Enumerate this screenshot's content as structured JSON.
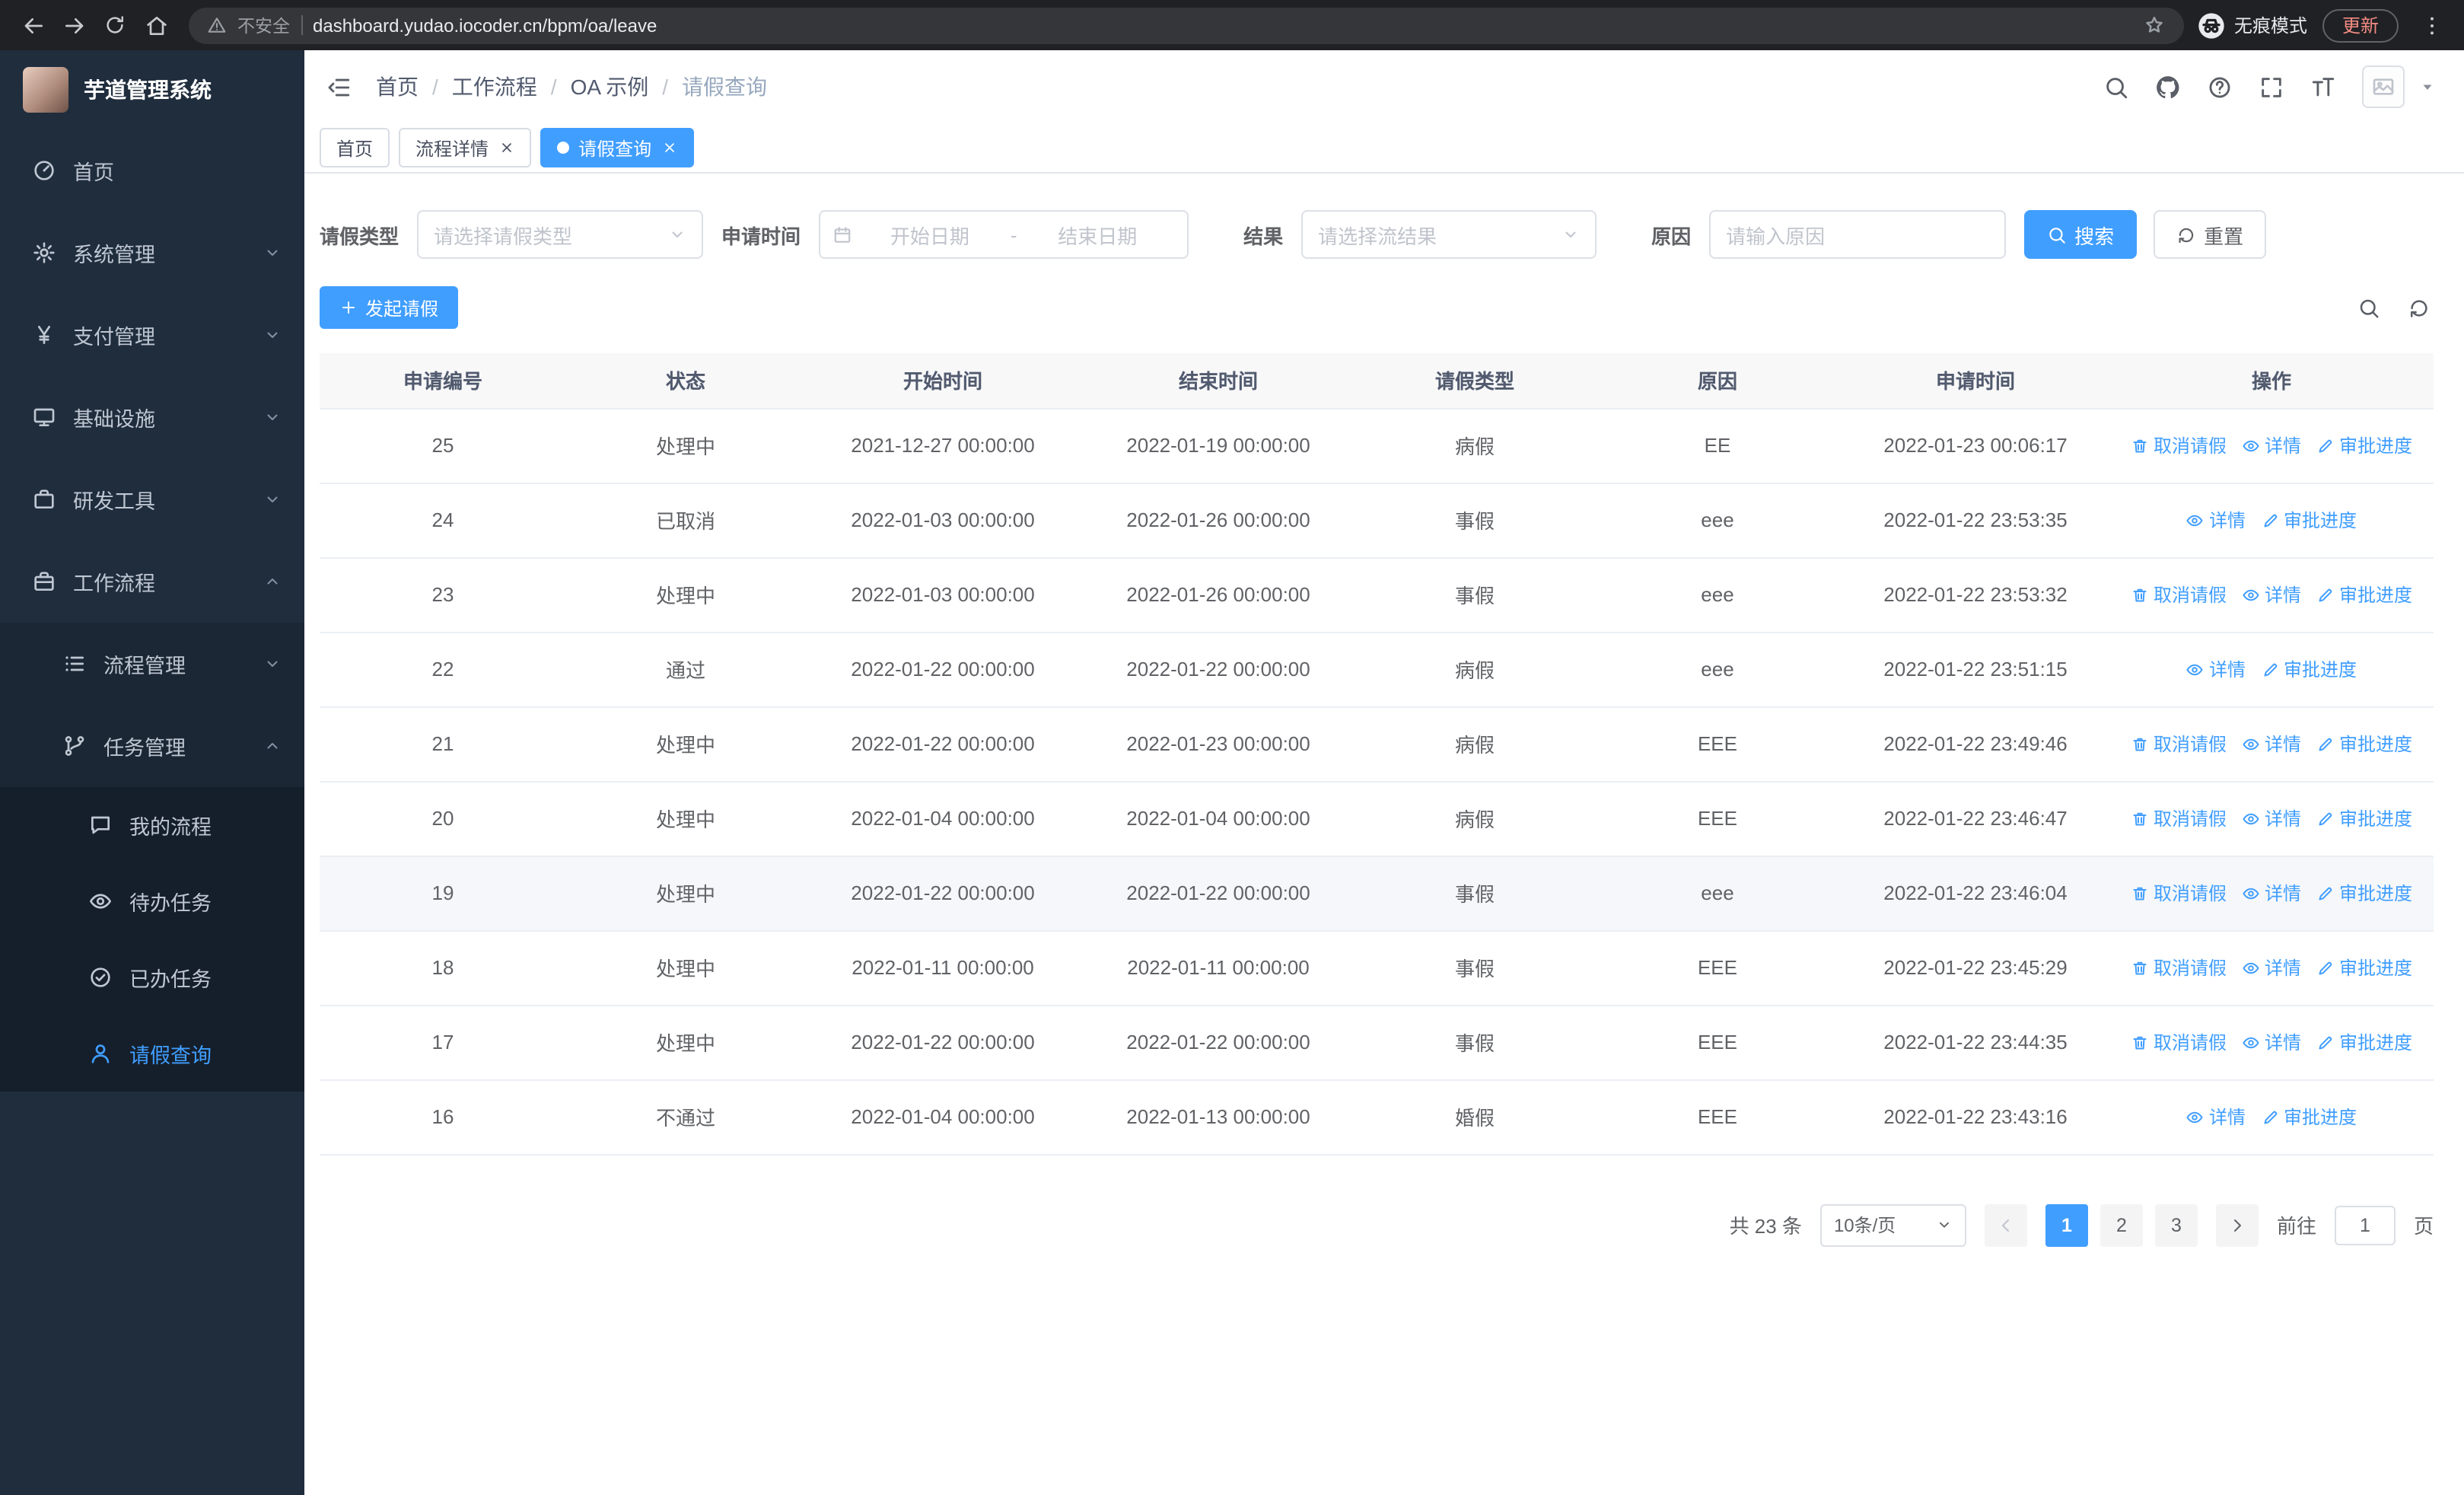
{
  "colors": {
    "primary": "#409EFF",
    "sidebar_bg": "#1F2D3D",
    "chrome_bg": "#202124",
    "update_text": "#F28B82",
    "table_header_bg": "#F8F8F9",
    "row_highlight_bg": "#F5F7FA"
  },
  "browser": {
    "security_warning": "不安全",
    "url": "dashboard.yudao.iocoder.cn/bpm/oa/leave",
    "incognito_label": "无痕模式",
    "update_label": "更新",
    "icons": [
      "back-icon",
      "forward-icon",
      "reload-icon",
      "home-icon",
      "warning-icon",
      "star-icon",
      "incognito-icon",
      "more-icon"
    ]
  },
  "sidebar": {
    "logo_title": "芋道管理系统",
    "menu": [
      {
        "id": "home",
        "label": "首页",
        "icon": "dashboard-icon",
        "level": 1
      },
      {
        "id": "system-mgmt",
        "label": "系统管理",
        "icon": "gear-icon",
        "level": 1,
        "chevron": "down"
      },
      {
        "id": "payment-mgmt",
        "label": "支付管理",
        "icon": "yen-icon",
        "level": 1,
        "chevron": "down"
      },
      {
        "id": "infrastructure",
        "label": "基础设施",
        "icon": "infra-icon",
        "level": 1,
        "chevron": "down"
      },
      {
        "id": "dev-tools",
        "label": "研发工具",
        "icon": "tools-icon",
        "level": 1,
        "chevron": "down"
      },
      {
        "id": "workflow",
        "label": "工作流程",
        "icon": "workflow-icon",
        "level": 1,
        "chevron": "up"
      },
      {
        "id": "process-mgmt",
        "label": "流程管理",
        "icon": "process-icon",
        "level": 2,
        "chevron": "down"
      },
      {
        "id": "task-mgmt",
        "label": "任务管理",
        "icon": "task-icon",
        "level": 2,
        "chevron": "up"
      },
      {
        "id": "my-process",
        "label": "我的流程",
        "icon": "chat-icon",
        "level": 3
      },
      {
        "id": "todo-task",
        "label": "待办任务",
        "icon": "eye-icon",
        "level": 3
      },
      {
        "id": "done-task",
        "label": "已办任务",
        "icon": "done-icon",
        "level": 3
      },
      {
        "id": "leave-query",
        "label": "请假查询",
        "icon": "user-icon",
        "level": 3,
        "active": true
      }
    ]
  },
  "header": {
    "breadcrumb": [
      "首页",
      "工作流程",
      "OA 示例",
      "请假查询"
    ],
    "icons": [
      "search-icon",
      "github-icon",
      "help-icon",
      "fullscreen-icon",
      "fontsize-icon"
    ]
  },
  "tabs": [
    {
      "id": "home",
      "label": "首页",
      "active": false,
      "closable": false
    },
    {
      "id": "process-detail",
      "label": "流程详情",
      "active": false,
      "closable": true
    },
    {
      "id": "leave-query",
      "label": "请假查询",
      "active": true,
      "closable": true
    }
  ],
  "filters": {
    "leave_type_label": "请假类型",
    "leave_type_placeholder": "请选择请假类型",
    "apply_time_label": "申请时间",
    "start_date_placeholder": "开始日期",
    "range_separator": "-",
    "end_date_placeholder": "结束日期",
    "result_label": "结果",
    "result_placeholder": "请选择流结果",
    "reason_label": "原因",
    "reason_placeholder": "请输入原因",
    "search_label": "搜索",
    "reset_label": "重置",
    "icons": [
      "calendar-icon",
      "chevron-down-icon",
      "search-icon",
      "refresh-icon"
    ]
  },
  "toolbar": {
    "create_label": "发起请假",
    "icons": [
      "plus-icon",
      "search-icon",
      "refresh-icon"
    ]
  },
  "table": {
    "columns": [
      "申请编号",
      "状态",
      "开始时间",
      "结束时间",
      "请假类型",
      "原因",
      "申请时间",
      "操作"
    ],
    "action_labels": {
      "cancel": "取消请假",
      "detail": "详情",
      "progress": "审批进度"
    },
    "action_icons": {
      "cancel": "trash-icon",
      "detail": "eye-icon",
      "progress": "edit-icon"
    },
    "rows": [
      {
        "id": "25",
        "status": "处理中",
        "start": "2021-12-27 00:00:00",
        "end": "2022-01-19 00:00:00",
        "type": "病假",
        "reason": "EE",
        "applied": "2022-01-23 00:06:17",
        "actions": [
          "cancel",
          "detail",
          "progress"
        ]
      },
      {
        "id": "24",
        "status": "已取消",
        "start": "2022-01-03 00:00:00",
        "end": "2022-01-26 00:00:00",
        "type": "事假",
        "reason": "eee",
        "applied": "2022-01-22 23:53:35",
        "actions": [
          "detail",
          "progress"
        ]
      },
      {
        "id": "23",
        "status": "处理中",
        "start": "2022-01-03 00:00:00",
        "end": "2022-01-26 00:00:00",
        "type": "事假",
        "reason": "eee",
        "applied": "2022-01-22 23:53:32",
        "actions": [
          "cancel",
          "detail",
          "progress"
        ]
      },
      {
        "id": "22",
        "status": "通过",
        "start": "2022-01-22 00:00:00",
        "end": "2022-01-22 00:00:00",
        "type": "病假",
        "reason": "eee",
        "applied": "2022-01-22 23:51:15",
        "actions": [
          "detail",
          "progress"
        ]
      },
      {
        "id": "21",
        "status": "处理中",
        "start": "2022-01-22 00:00:00",
        "end": "2022-01-23 00:00:00",
        "type": "病假",
        "reason": "EEE",
        "applied": "2022-01-22 23:49:46",
        "actions": [
          "cancel",
          "detail",
          "progress"
        ]
      },
      {
        "id": "20",
        "status": "处理中",
        "start": "2022-01-04 00:00:00",
        "end": "2022-01-04 00:00:00",
        "type": "病假",
        "reason": "EEE",
        "applied": "2022-01-22 23:46:47",
        "actions": [
          "cancel",
          "detail",
          "progress"
        ]
      },
      {
        "id": "19",
        "status": "处理中",
        "start": "2022-01-22 00:00:00",
        "end": "2022-01-22 00:00:00",
        "type": "事假",
        "reason": "eee",
        "applied": "2022-01-22 23:46:04",
        "actions": [
          "cancel",
          "detail",
          "progress"
        ],
        "highlight": true
      },
      {
        "id": "18",
        "status": "处理中",
        "start": "2022-01-11 00:00:00",
        "end": "2022-01-11 00:00:00",
        "type": "事假",
        "reason": "EEE",
        "applied": "2022-01-22 23:45:29",
        "actions": [
          "cancel",
          "detail",
          "progress"
        ]
      },
      {
        "id": "17",
        "status": "处理中",
        "start": "2022-01-22 00:00:00",
        "end": "2022-01-22 00:00:00",
        "type": "事假",
        "reason": "EEE",
        "applied": "2022-01-22 23:44:35",
        "actions": [
          "cancel",
          "detail",
          "progress"
        ]
      },
      {
        "id": "16",
        "status": "不通过",
        "start": "2022-01-04 00:00:00",
        "end": "2022-01-13 00:00:00",
        "type": "婚假",
        "reason": "EEE",
        "applied": "2022-01-22 23:43:16",
        "actions": [
          "detail",
          "progress"
        ]
      }
    ]
  },
  "pagination": {
    "total_text": "共 23 条",
    "page_size_value": "10条/页",
    "pages": [
      "1",
      "2",
      "3"
    ],
    "active_page": "1",
    "goto_label": "前往",
    "goto_value": "1",
    "page_unit_label": "页"
  }
}
